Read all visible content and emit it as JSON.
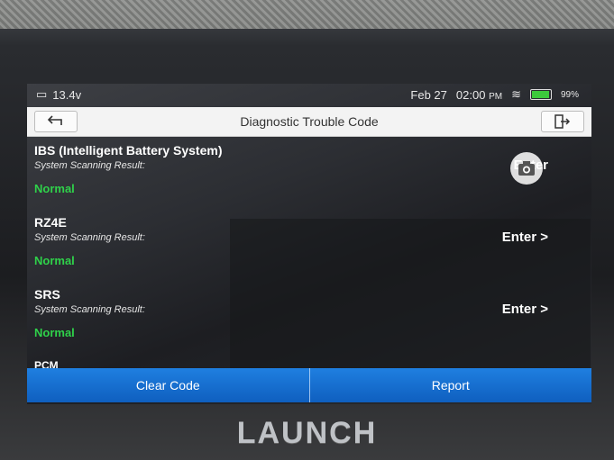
{
  "device": {
    "brand": "LAUNCH"
  },
  "statusbar": {
    "voltage": "13.4v",
    "date": "Feb 27",
    "time": "02:00",
    "ampm": "PM",
    "battery": "99%"
  },
  "header": {
    "title": "Diagnostic Trouble Code"
  },
  "systems": [
    {
      "name": "IBS (Intelligent Battery System)",
      "label": "System Scanning Result:",
      "status": "Normal",
      "action": "Enter"
    },
    {
      "name": "RZ4E",
      "label": "System Scanning Result:",
      "status": "Normal",
      "action": "Enter >"
    },
    {
      "name": "SRS",
      "label": "System Scanning Result:",
      "status": "Normal",
      "action": "Enter >"
    }
  ],
  "partial_row": "PCM",
  "footer": {
    "clear_label": "Clear Code",
    "report_label": "Report"
  },
  "icons": {
    "back": "back-arrow-icon",
    "exit": "exit-icon",
    "camera": "camera-icon",
    "wifi": "wifi-icon",
    "battery": "battery-icon"
  },
  "colors": {
    "normal": "#2fd14a",
    "action_bar": "#1f7fe0"
  }
}
